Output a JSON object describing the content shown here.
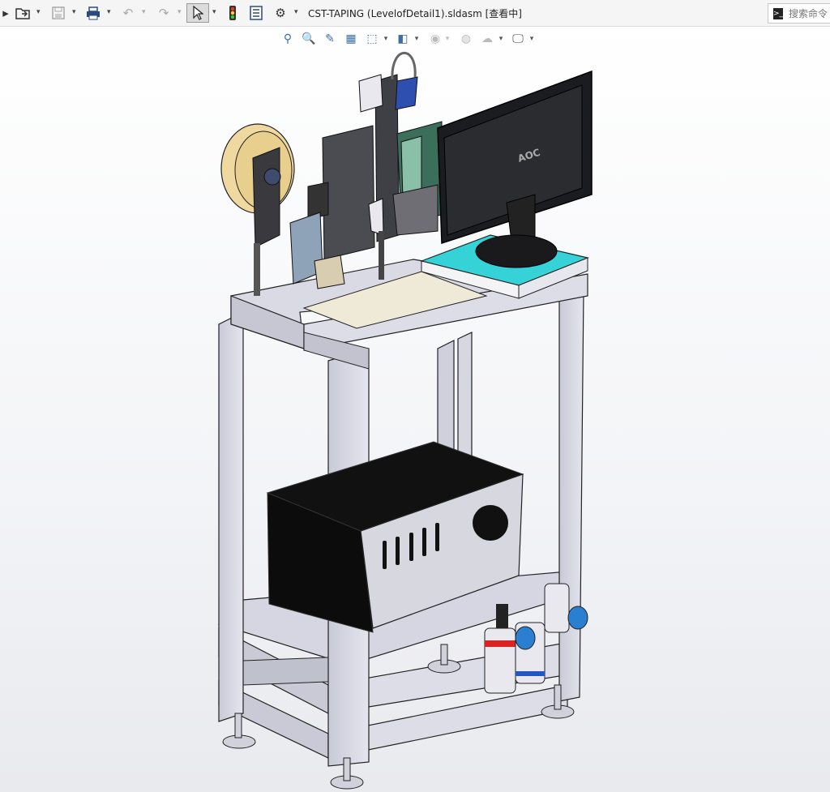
{
  "window": {
    "title": "CST-TAPING (LevelofDetail1).sldasm [查看中]"
  },
  "toolbar": {
    "items": [
      {
        "name": "new-file-icon",
        "glyph": "⇢"
      },
      {
        "name": "open-file-icon",
        "glyph": "📂"
      },
      {
        "name": "save-icon",
        "glyph": "💾"
      },
      {
        "name": "print-icon",
        "glyph": "🖶"
      },
      {
        "name": "undo-icon",
        "glyph": "↶"
      },
      {
        "name": "redo-icon",
        "glyph": "↷"
      },
      {
        "name": "select-pointer-icon",
        "glyph": "↖"
      },
      {
        "name": "traffic-light-icon",
        "glyph": "●"
      },
      {
        "name": "file-properties-icon",
        "glyph": "☰"
      },
      {
        "name": "options-gear-icon",
        "glyph": "⚙"
      }
    ]
  },
  "search": {
    "placeholder": "搜索命令"
  },
  "monitor": {
    "brand": "AOC"
  },
  "heads_up": {
    "items": [
      "zoom-to-fit-icon",
      "zoom-to-area-icon",
      "previous-view-icon",
      "section-view-icon",
      "view-orientation-icon",
      "display-style-icon",
      "hide-show-icon",
      "edit-appearance-icon",
      "apply-scene-icon",
      "view-settings-icon"
    ]
  }
}
